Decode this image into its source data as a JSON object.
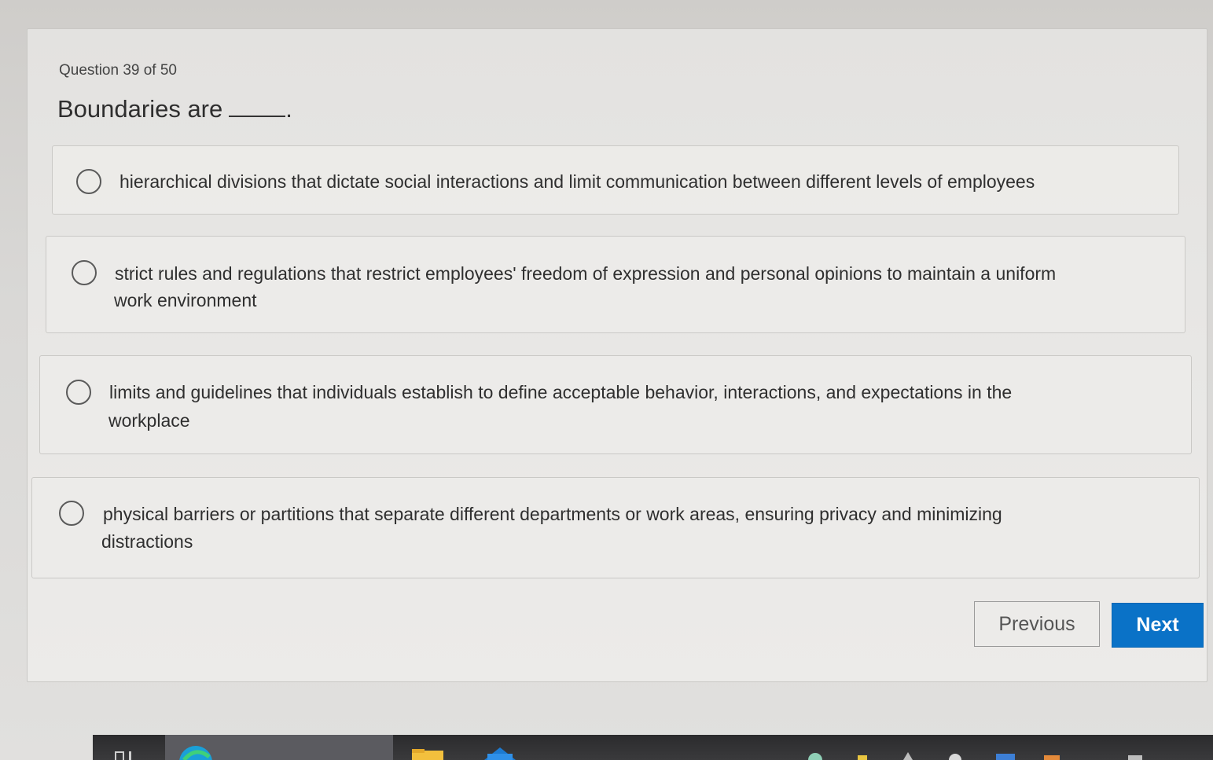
{
  "quiz": {
    "counter": "Question 39 of 50",
    "question": "Boundaries are",
    "question_end": "."
  },
  "options": [
    {
      "text": "hierarchical divisions that dictate social interactions and limit communication between different levels of employees"
    },
    {
      "line1": "strict rules and regulations that restrict employees' freedom of expression and personal opinions to maintain a uniform",
      "line2": "work environment"
    },
    {
      "line1": "limits and guidelines that individuals establish to define acceptable behavior, interactions, and expectations in the",
      "line2": "workplace"
    },
    {
      "line1": "physical barriers or partitions that separate different departments or work areas, ensuring privacy and minimizing",
      "line2": "distractions"
    }
  ],
  "navigation": {
    "previous_label": "Previous",
    "next_label": "Next"
  },
  "colors": {
    "next_button": "#0a72c7",
    "taskbar": "#2b2b2d"
  },
  "taskbar": {
    "icons": [
      "task-view-icon",
      "edge-browser-icon",
      "file-explorer-icon",
      "mail-icon",
      "system-tray-icons"
    ]
  }
}
